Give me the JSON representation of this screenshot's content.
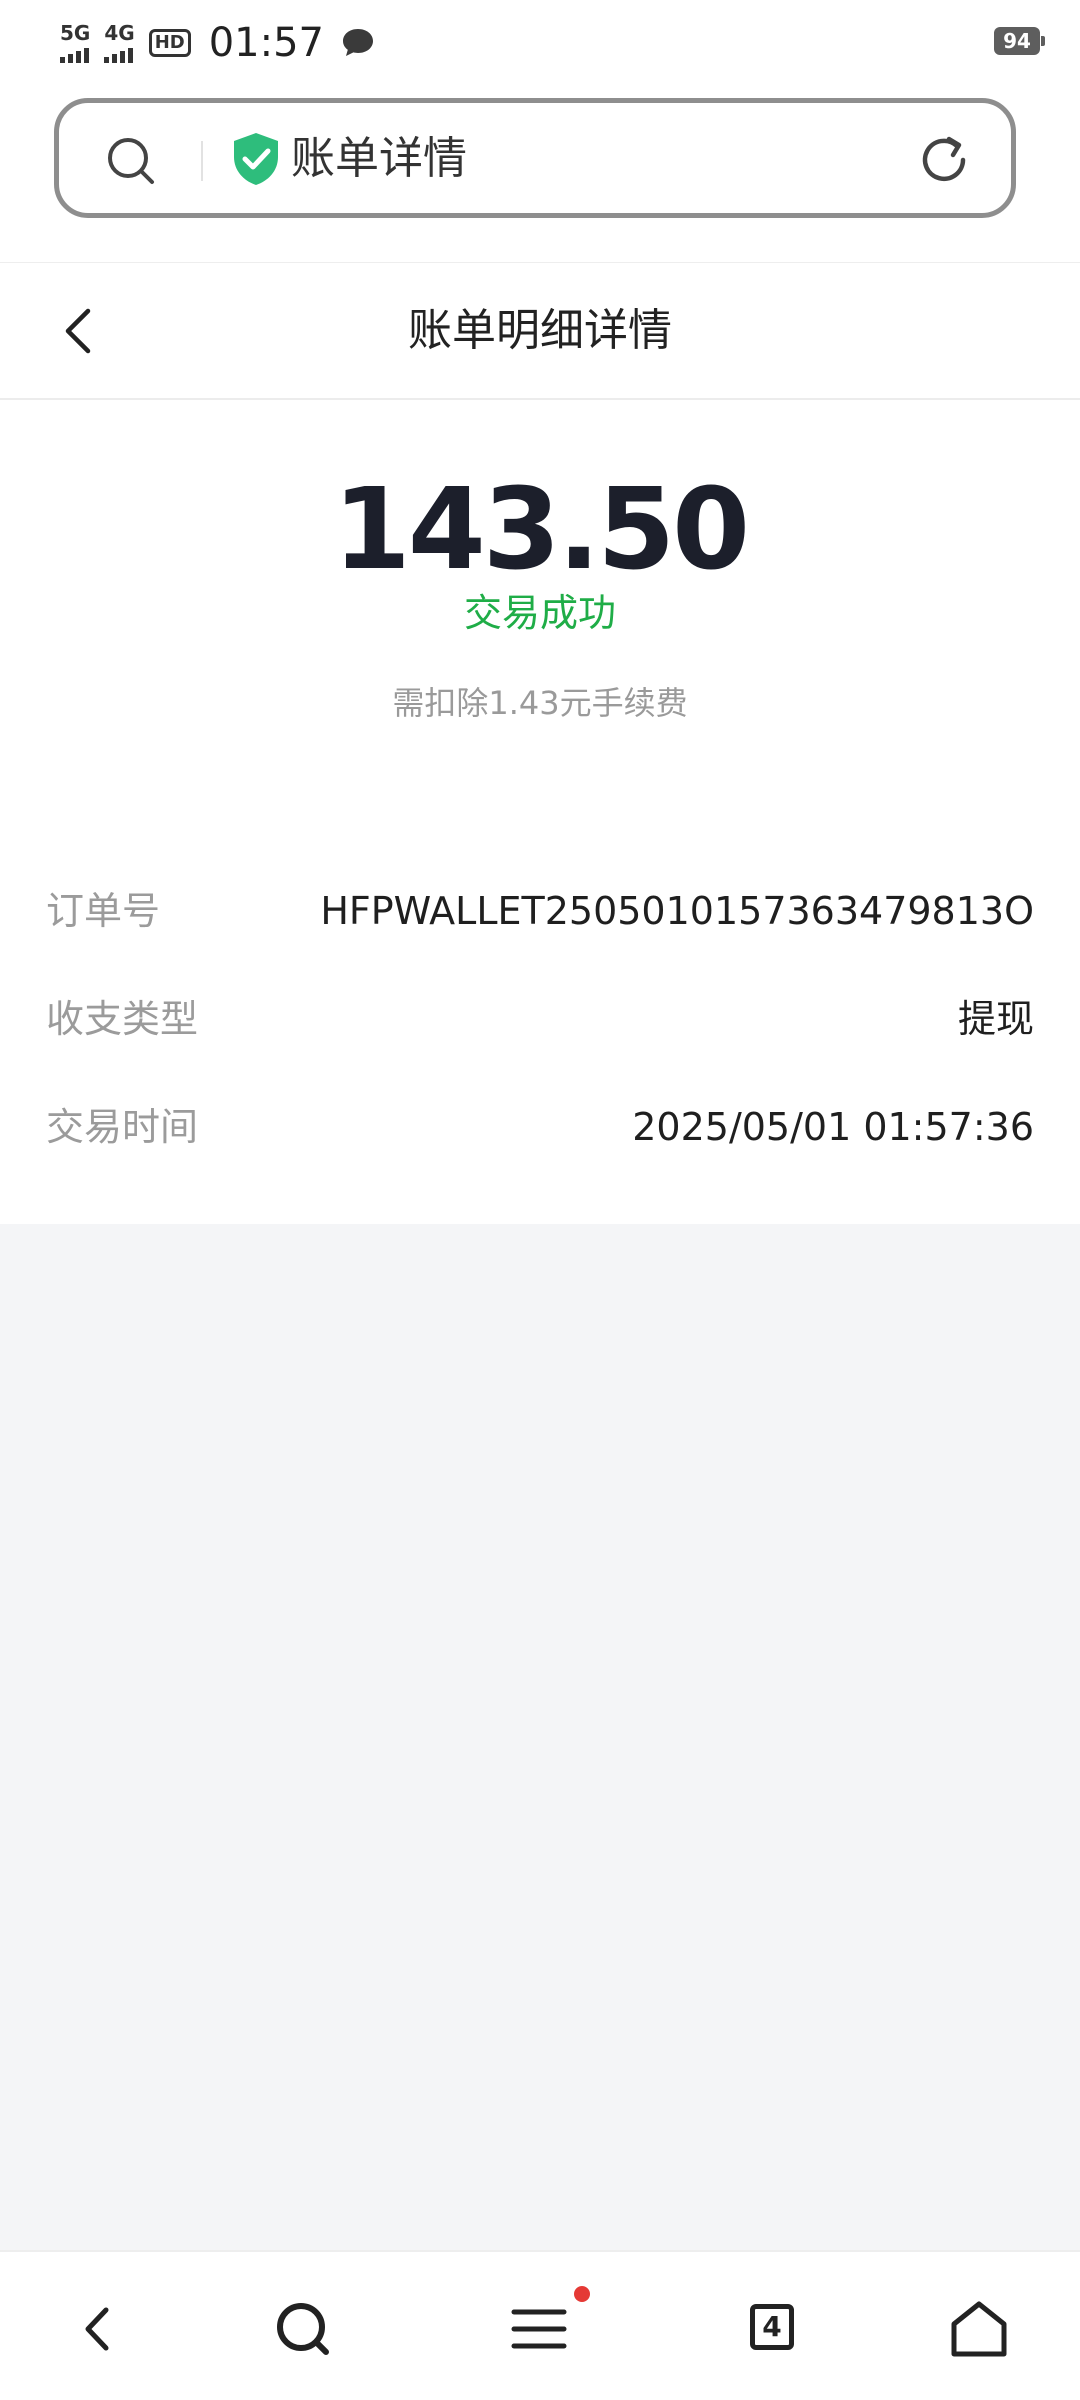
{
  "status_bar": {
    "signal1": "5G",
    "signal2": "4G",
    "hd_label": "HD",
    "time": "01:57",
    "battery": "94"
  },
  "url_bar": {
    "title": "账单详情"
  },
  "header": {
    "title": "账单明细详情"
  },
  "summary": {
    "amount": "143.50",
    "status": "交易成功",
    "fee_note": "需扣除1.43元手续费"
  },
  "details": [
    {
      "label": "订单号",
      "value": "HFPWALLET2505010157363479813O"
    },
    {
      "label": "收支类型",
      "value": "提现"
    },
    {
      "label": "交易时间",
      "value": "2025/05/01 01:57:36"
    }
  ],
  "bottom_nav": {
    "tab_count": "4"
  },
  "colors": {
    "success": "#1fad47",
    "shield": "#2ebd7c",
    "badge": "#e53935"
  }
}
